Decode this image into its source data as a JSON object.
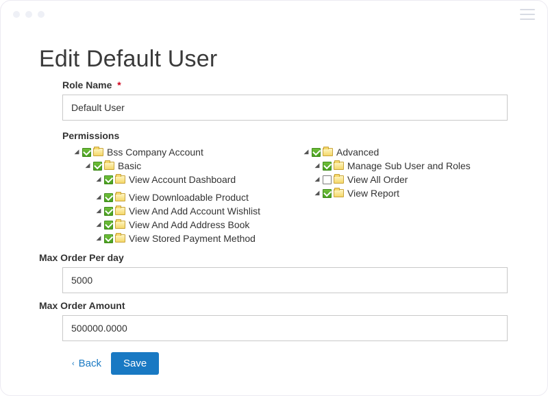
{
  "page": {
    "title": "Edit Default User"
  },
  "fields": {
    "role_name": {
      "label": "Role Name",
      "value": "Default User"
    },
    "permissions_label": "Permissions",
    "max_order_per_day": {
      "label": "Max Order Per day",
      "value": "5000"
    },
    "max_order_amount": {
      "label": "Max Order Amount",
      "value": "500000.0000"
    }
  },
  "tree_left": {
    "root": {
      "label": "Bss Company Account",
      "checked": true
    },
    "basic": {
      "label": "Basic",
      "checked": true
    },
    "basic_children": [
      {
        "label": "View Account Dashboard",
        "checked": true
      },
      {
        "label": "View Downloadable Product",
        "checked": true
      },
      {
        "label": "View And Add Account Wishlist",
        "checked": true
      },
      {
        "label": "View And Add Address Book",
        "checked": true
      },
      {
        "label": "View Stored Payment Method",
        "checked": true
      }
    ]
  },
  "tree_right": {
    "root": {
      "label": "Advanced",
      "checked": true
    },
    "children": [
      {
        "label": "Manage Sub User and Roles",
        "checked": true
      },
      {
        "label": "View All Order",
        "checked": false
      },
      {
        "label": "View Report",
        "checked": true
      }
    ]
  },
  "actions": {
    "back": "Back",
    "save": "Save"
  }
}
